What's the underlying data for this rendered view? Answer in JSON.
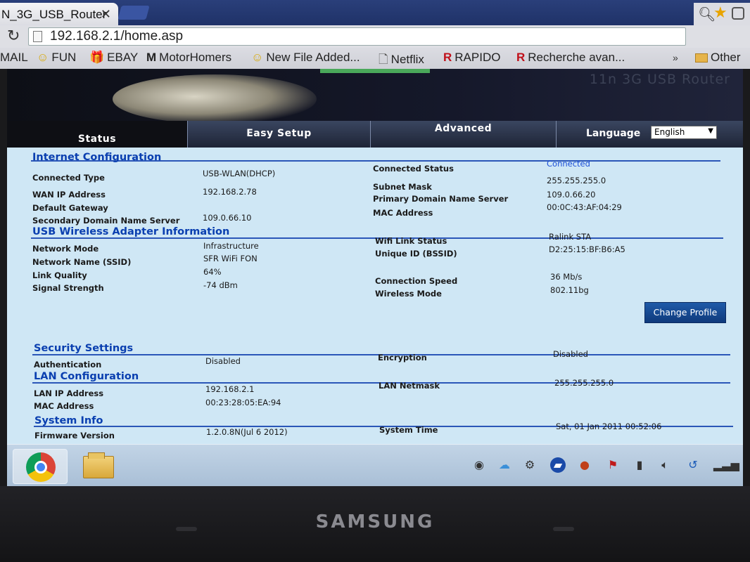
{
  "browser": {
    "tab_title": "N_3G_USB_Router",
    "tab_close": "✕",
    "url": "192.168.2.1/home.asp",
    "bookmarks": [
      {
        "icon": "",
        "label": "MAIL"
      },
      {
        "icon": "☺",
        "label": "FUN"
      },
      {
        "icon": "🎁",
        "label": "EBAY"
      },
      {
        "icon": "M",
        "label": "MotorHomers"
      },
      {
        "icon": "☺",
        "label": "New File Added..."
      },
      {
        "icon": "🗋",
        "label": "Netflix"
      },
      {
        "icon": "R",
        "label": "RAPIDO"
      },
      {
        "icon": "R",
        "label": "Recherche avan..."
      }
    ],
    "overflow_chevron": "»",
    "other_bookmarks": "Other"
  },
  "router": {
    "banner_title": "11n 3G USB Router",
    "nav": {
      "status": "Status",
      "easy_setup": "Easy Setup",
      "advanced": "Advanced",
      "language_label": "Language",
      "language_value": "English"
    },
    "internet": {
      "title": "Internet Configuration",
      "connected_type_label": "Connected Type",
      "connected_type": "USB-WLAN(DHCP)",
      "wan_ip_label": "WAN IP Address",
      "wan_ip": "192.168.2.78",
      "gateway_label": "Default Gateway",
      "gateway": "",
      "secondary_dns_label": "Secondary Domain Name Server",
      "secondary_dns": "109.0.66.10",
      "connected_status_label": "Connected Status",
      "connected_status": "Connected",
      "subnet_label": "Subnet Mask",
      "subnet": "255.255.255.0",
      "primary_dns_label": "Primary Domain Name Server",
      "primary_dns": "109.0.66.20",
      "mac_label": "MAC Address",
      "mac": "00:0C:43:AF:04:29"
    },
    "usb_wireless": {
      "title": "USB Wireless Adapter Information",
      "mode_label": "Network Mode",
      "mode": "Infrastructure",
      "ssid_label": "Network Name (SSID)",
      "ssid": "SFR WiFi FON",
      "quality_label": "Link Quality",
      "quality": "64%",
      "signal_label": "Signal Strength",
      "signal": "-74 dBm",
      "link_status_label": "Wifi Link Status",
      "link_status": "Ralink STA",
      "bssid_label": "Unique ID (BSSID)",
      "bssid": "D2:25:15:BF:B6:A5",
      "speed_label": "Connection Speed",
      "speed": "36 Mb/s",
      "wmode_label": "Wireless Mode",
      "wmode": "802.11bg",
      "change_profile": "Change Profile"
    },
    "security": {
      "title": "Security Settings",
      "auth_label": "Authentication",
      "auth": "Disabled",
      "enc_label": "Encryption",
      "enc": "Disabled"
    },
    "lan": {
      "title": "LAN Configuration",
      "ip_label": "LAN IP Address",
      "ip": "192.168.2.1",
      "mac_label": "MAC Address",
      "mac": "00:23:28:05:EA:94",
      "netmask_label": "LAN Netmask",
      "netmask": "255.255.255.0"
    },
    "system": {
      "title": "System Info",
      "fw_label": "Firmware Version",
      "fw": "1.2.0.8N(Jul 6 2012)",
      "time_label": "System Time",
      "time": "Sat, 01 Jan 2011 00:52:06"
    }
  },
  "laptop": {
    "brand": "SAMSUNG"
  }
}
